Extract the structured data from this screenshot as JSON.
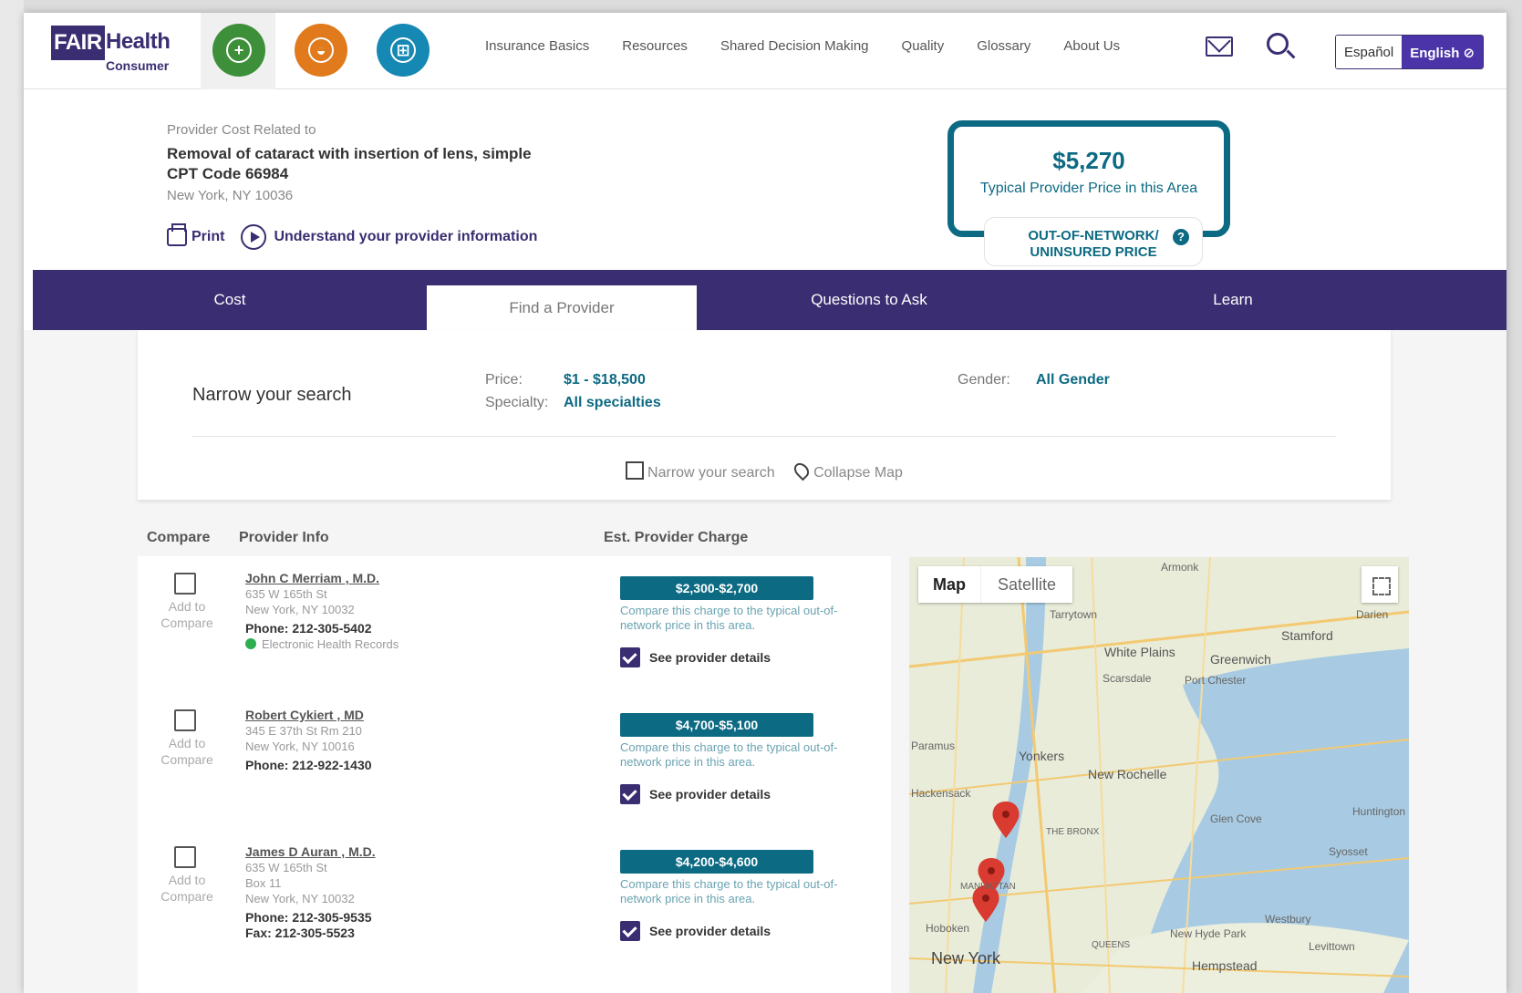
{
  "header": {
    "logo_fair": "FAIR",
    "logo_health": "Health",
    "logo_consumer": "Consumer",
    "nav": [
      "Insurance Basics",
      "Resources",
      "Shared Decision Making",
      "Quality",
      "Glossary",
      "About Us"
    ],
    "lang_es": "Español",
    "lang_en": "English ⊘",
    "colors": {
      "brand": "#3a2d71",
      "medical": "#3e8f3a",
      "dental": "#e07a1c",
      "cart": "#1588b3"
    }
  },
  "summary": {
    "pre": "Provider Cost Related to",
    "procedure": "Removal of cataract with insertion of lens, simple",
    "cpt": "CPT Code 66984",
    "location": "New York, NY 10036",
    "print": "Print",
    "understand": "Understand your provider information",
    "price": "$5,270",
    "price_sub": "Typical Provider Price in this Area",
    "oon_line1": "OUT-OF-NETWORK/",
    "oon_line2": "UNINSURED PRICE",
    "oon_help": "?"
  },
  "tabs": [
    "Cost",
    "Find a Provider",
    "Questions to Ask",
    "Learn"
  ],
  "narrow": {
    "title": "Narrow your search",
    "price_label": "Price:",
    "price_value": "$1 - $18,500",
    "specialty_label": "Specialty:",
    "specialty_value": "All specialties",
    "gender_label": "Gender:",
    "gender_value": "All Gender",
    "narrow_link": "Narrow your search",
    "collapse_link": "Collapse Map"
  },
  "columns": {
    "compare": "Compare",
    "provider_info": "Provider Info",
    "charge": "Est. Provider Charge"
  },
  "providers": [
    {
      "add": "Add to Compare",
      "name": "John C Merriam , M.D.",
      "addr1": "635 W 165th St",
      "addr2": "New York, NY 10032",
      "phone": "Phone: 212-305-5402",
      "ehr": "Electronic Health Records",
      "charge": "$2,300-$2,700",
      "compare": "Compare this charge to the typical out-of-network price in this area.",
      "see": "See provider details"
    },
    {
      "add": "Add to Compare",
      "name": "Robert Cykiert , MD",
      "addr1": "345 E 37th St Rm 210",
      "addr2": "New York, NY 10016",
      "phone": "Phone: 212-922-1430",
      "charge": "$4,700-$5,100",
      "compare": "Compare this charge to the typical out-of-network price in this area.",
      "see": "See provider details"
    },
    {
      "add": "Add to Compare",
      "name": "James D Auran , M.D.",
      "addr1": "635 W 165th St",
      "addr2": "Box 11",
      "addr3": "New York, NY 10032",
      "phone": "Phone: 212-305-9535",
      "fax": "Fax: 212-305-5523",
      "charge": "$4,200-$4,600",
      "compare": "Compare this charge to the typical out-of-network price in this area.",
      "see": "See provider details"
    }
  ],
  "map": {
    "map_btn": "Map",
    "satellite_btn": "Satellite",
    "labels": [
      "Armonk",
      "Tarrytown",
      "White Plains",
      "Scarsdale",
      "Stamford",
      "Greenwich",
      "Port Chester",
      "Yonkers",
      "New Rochelle",
      "Hackensack",
      "Glen Cove",
      "Huntington",
      "Syosset",
      "Hoboken",
      "New York",
      "Hempstead",
      "Westbury",
      "Levittown",
      "New Hyde Park",
      "Darien",
      "THE BRONX",
      "QUEENS",
      "MANHATTAN",
      "Paramus"
    ]
  }
}
